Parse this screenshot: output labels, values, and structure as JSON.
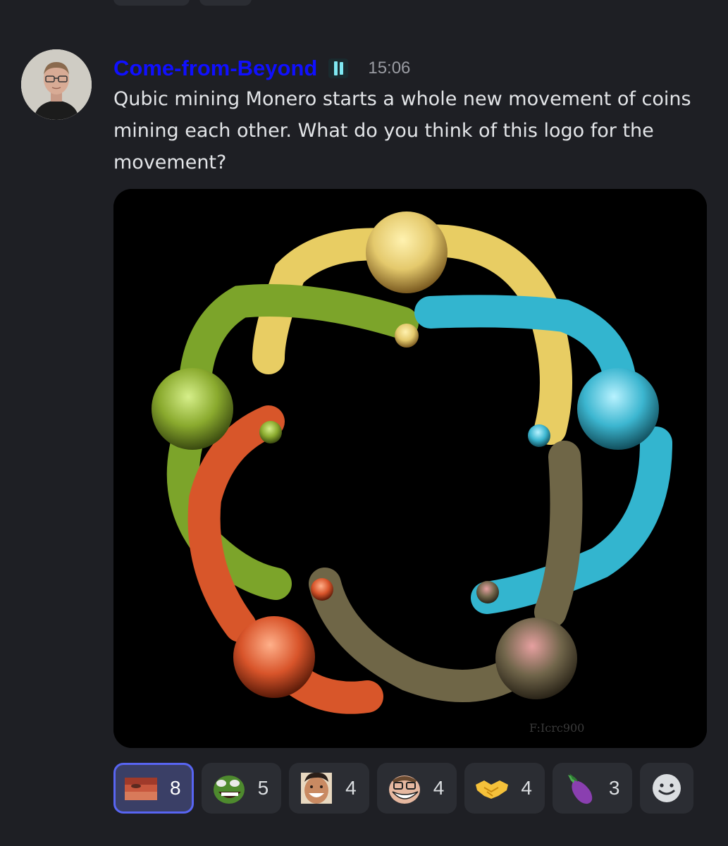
{
  "message": {
    "author": "Come-from-Beyond",
    "author_color": "#1010ff",
    "badge_icon": "pause-badge-icon",
    "timestamp": "15:06",
    "text": "Qubic mining Monero starts a whole new movement of coins mining each other. What do you think of this logo for the movement?",
    "attachment": {
      "watermark": "F:Icrc900"
    }
  },
  "reactions": [
    {
      "emoji": "face-crop-emoji",
      "count": "8",
      "selected": true
    },
    {
      "emoji": "pepe-laughing-emoji",
      "count": "5",
      "selected": false
    },
    {
      "emoji": "smiling-man-emoji",
      "count": "4",
      "selected": false
    },
    {
      "emoji": "trollface-glasses-emoji",
      "count": "4",
      "selected": false
    },
    {
      "emoji": "handshake-emoji",
      "count": "4",
      "selected": false
    },
    {
      "emoji": "eggplant-emoji",
      "count": "3",
      "selected": false
    }
  ],
  "add_reaction_icon": "smiley-add-icon"
}
